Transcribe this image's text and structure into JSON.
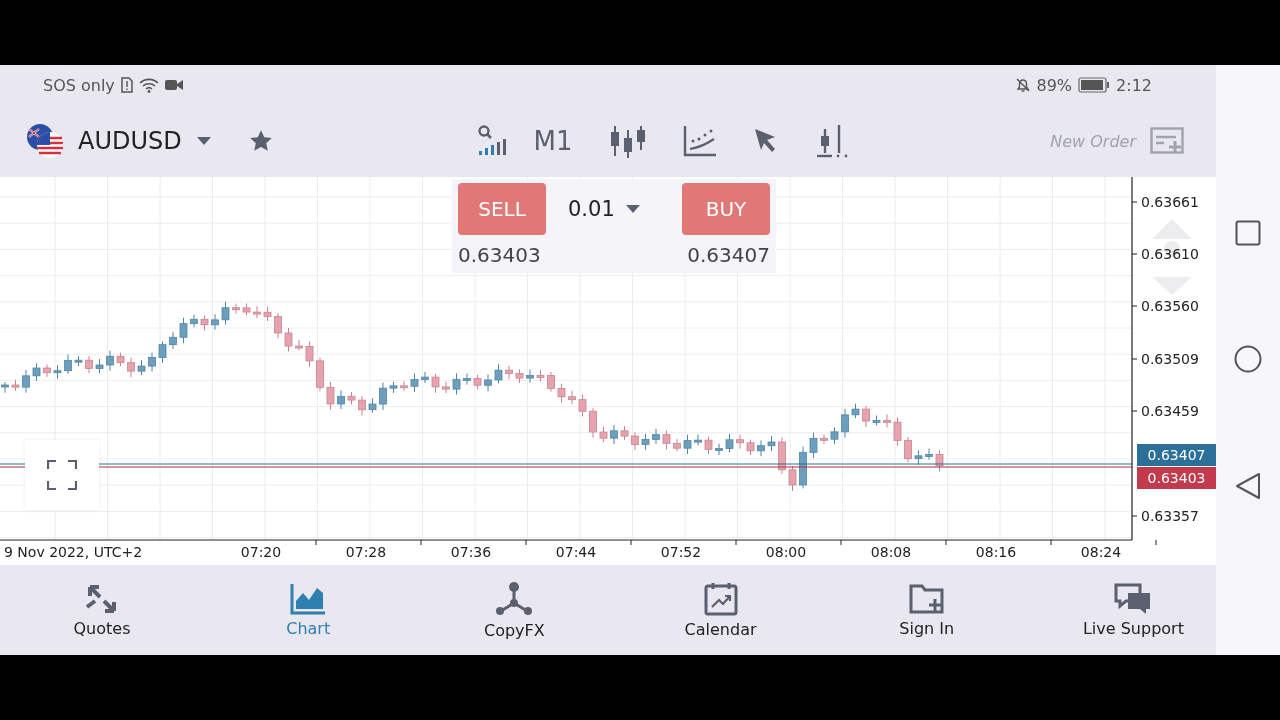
{
  "status_bar": {
    "carrier": "SOS only",
    "battery": "89%",
    "time": "2:12"
  },
  "toolbar": {
    "symbol": "AUDUSD",
    "timeframe": "M1",
    "new_order": "New Order"
  },
  "trade_panel": {
    "sell": "SELL",
    "lot": "0.01",
    "buy": "BUY",
    "bid": "0.63403",
    "ask": "0.63407"
  },
  "chart": {
    "price_ticks": [
      "0.63661",
      "0.63610",
      "0.63560",
      "0.63509",
      "0.63459",
      "0.63357"
    ],
    "date_label": "9 Nov 2022, UTC+2",
    "time_labels": [
      "07:20",
      "07:28",
      "07:36",
      "07:44",
      "07:52",
      "08:00",
      "08:08",
      "08:16",
      "08:24"
    ],
    "ask_badge": "0.63407",
    "bid_badge": "0.63403"
  },
  "bottom_nav": [
    {
      "label": "Quotes",
      "kind": "quotes",
      "selected": false
    },
    {
      "label": "Chart",
      "kind": "chart",
      "selected": true
    },
    {
      "label": "CopyFX",
      "kind": "copyfx",
      "selected": false
    },
    {
      "label": "Calendar",
      "kind": "calendar",
      "selected": false
    },
    {
      "label": "Sign In",
      "kind": "signin",
      "selected": false
    },
    {
      "label": "Live Support",
      "kind": "support",
      "selected": false
    }
  ]
}
